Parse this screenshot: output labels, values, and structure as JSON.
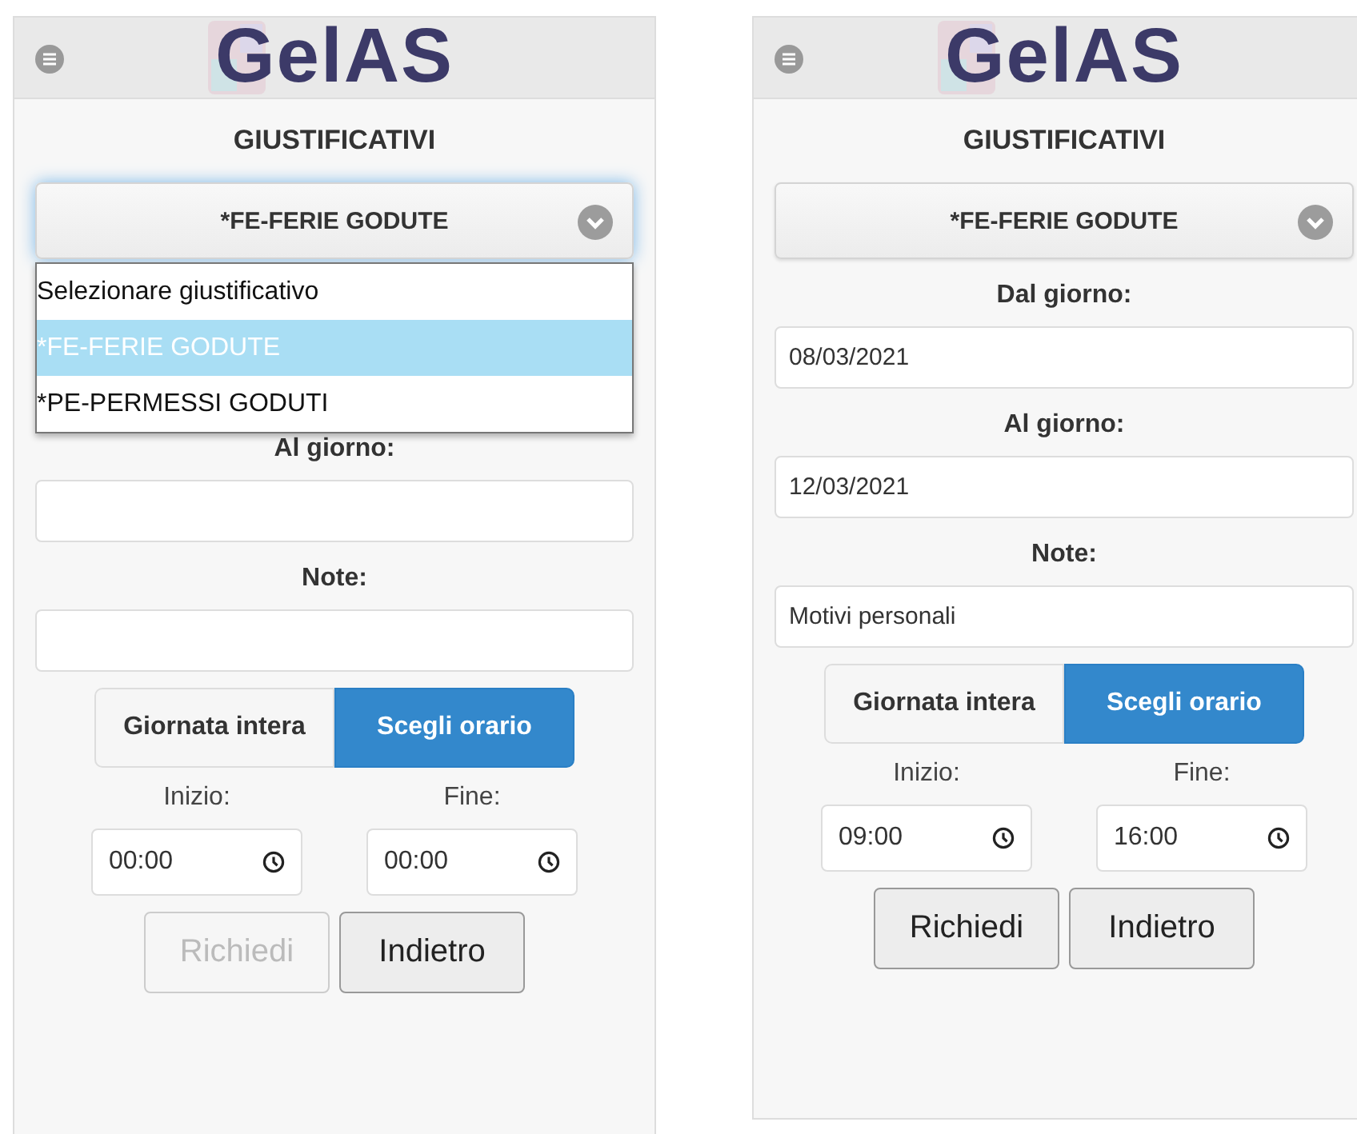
{
  "screens": [
    {
      "logo": "GelAS",
      "title": "GIUSTIFICATIVI",
      "select": {
        "value": "*FE-FERIE GODUTE",
        "open": true,
        "options": [
          {
            "label": "Selezionare giustificativo",
            "selected": false
          },
          {
            "label": "*FE-FERIE GODUTE",
            "selected": true
          },
          {
            "label": "*PE-PERMESSI GODUTI",
            "selected": false
          }
        ]
      },
      "fields": [
        {
          "label": "Al giorno:"
        },
        {
          "label": "Note:"
        }
      ],
      "mode_toggle": [
        {
          "label": "Giornata intera",
          "selected": false
        },
        {
          "label": "Scegli orario",
          "selected": true
        }
      ],
      "times": [
        {
          "label": "Inizio:",
          "value": "00:00"
        },
        {
          "label": "Fine:",
          "value": "00:00"
        }
      ],
      "buttons": [
        {
          "label": "Richiedi",
          "disabled": true
        },
        {
          "label": "Indietro",
          "disabled": false
        }
      ]
    },
    {
      "logo": "GelAS",
      "title": "GIUSTIFICATIVI",
      "select": {
        "value": "*FE-FERIE GODUTE",
        "open": false
      },
      "fields": [
        {
          "label": "Dal giorno:",
          "value": "08/03/2021"
        },
        {
          "label": "Al giorno:",
          "value": "12/03/2021"
        },
        {
          "label": "Note:",
          "value": "Motivi personali"
        }
      ],
      "mode_toggle": [
        {
          "label": "Giornata intera",
          "selected": false
        },
        {
          "label": "Scegli orario",
          "selected": true
        }
      ],
      "times": [
        {
          "label": "Inizio:",
          "value": "09:00"
        },
        {
          "label": "Fine:",
          "value": "16:00"
        }
      ],
      "buttons": [
        {
          "label": "Richiedi",
          "disabled": false
        },
        {
          "label": "Indietro",
          "disabled": false
        }
      ]
    }
  ]
}
